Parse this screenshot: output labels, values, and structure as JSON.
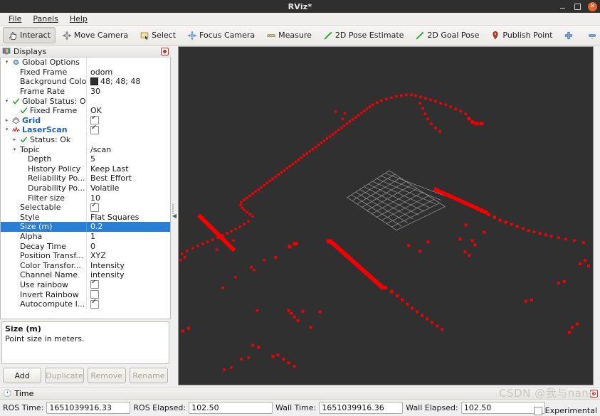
{
  "window": {
    "title": "RViz*",
    "min_label": "minimize",
    "max_label": "maximize",
    "close_label": "✕"
  },
  "menubar": [
    {
      "label": "File",
      "accel": "F"
    },
    {
      "label": "Panels",
      "accel": "P"
    },
    {
      "label": "Help",
      "accel": "H"
    }
  ],
  "toolbar": [
    {
      "label": "Interact",
      "icon": "hand-icon",
      "active": true
    },
    {
      "label": "Move Camera",
      "icon": "move-camera-icon",
      "active": false
    },
    {
      "label": "Select",
      "icon": "select-rect-icon",
      "active": false
    },
    {
      "label": "Focus Camera",
      "icon": "focus-camera-icon",
      "active": false
    },
    {
      "label": "Measure",
      "icon": "measure-icon",
      "active": false
    },
    {
      "label": "2D Pose Estimate",
      "icon": "pose-arrow-icon",
      "active": false
    },
    {
      "label": "2D Goal Pose",
      "icon": "pose-arrow-icon",
      "active": false
    },
    {
      "label": "Publish Point",
      "icon": "map-pin-icon",
      "active": false
    },
    {
      "label": "",
      "icon": "plus-icon",
      "active": false
    },
    {
      "label": "",
      "icon": "minus-icon",
      "active": false
    }
  ],
  "displays_panel": {
    "title": "Displays",
    "rows": [
      {
        "indent": 0,
        "arrow": "down",
        "icon": "gear-icon",
        "name": "Global Options",
        "style": "plain",
        "value": "",
        "value_type": "none"
      },
      {
        "indent": 1,
        "arrow": "none",
        "icon": "",
        "name": "Fixed Frame",
        "style": "plain",
        "value": "odom",
        "value_type": "text"
      },
      {
        "indent": 1,
        "arrow": "none",
        "icon": "",
        "name": "Background Color",
        "style": "plain",
        "value": "48; 48; 48",
        "value_type": "color"
      },
      {
        "indent": 1,
        "arrow": "none",
        "icon": "",
        "name": "Frame Rate",
        "style": "plain",
        "value": "30",
        "value_type": "text"
      },
      {
        "indent": 0,
        "arrow": "down",
        "icon": "check-icon",
        "name": "Global Status: Ok",
        "style": "plain",
        "value": "",
        "value_type": "none"
      },
      {
        "indent": 1,
        "arrow": "none",
        "icon": "check-icon",
        "name": "Fixed Frame",
        "style": "plain",
        "value": "OK",
        "value_type": "text"
      },
      {
        "indent": 0,
        "arrow": "right",
        "icon": "grid-icon",
        "name": "Grid",
        "style": "blue",
        "value": "",
        "value_type": "check-on"
      },
      {
        "indent": 0,
        "arrow": "down",
        "icon": "scan-icon",
        "name": "LaserScan",
        "style": "blue",
        "value": "",
        "value_type": "check-on"
      },
      {
        "indent": 1,
        "arrow": "right",
        "icon": "check-icon",
        "name": "Status: Ok",
        "style": "plain",
        "value": "",
        "value_type": "none"
      },
      {
        "indent": 1,
        "arrow": "down",
        "icon": "",
        "name": "Topic",
        "style": "plain",
        "value": "/scan",
        "value_type": "text"
      },
      {
        "indent": 2,
        "arrow": "none",
        "icon": "",
        "name": "Depth",
        "style": "plain",
        "value": "5",
        "value_type": "text"
      },
      {
        "indent": 2,
        "arrow": "none",
        "icon": "",
        "name": "History Policy",
        "style": "plain",
        "value": "Keep Last",
        "value_type": "text"
      },
      {
        "indent": 2,
        "arrow": "none",
        "icon": "",
        "name": "Reliability Po...",
        "style": "plain",
        "value": "Best Effort",
        "value_type": "text"
      },
      {
        "indent": 2,
        "arrow": "none",
        "icon": "",
        "name": "Durability Po...",
        "style": "plain",
        "value": "Volatile",
        "value_type": "text"
      },
      {
        "indent": 2,
        "arrow": "none",
        "icon": "",
        "name": "Filter size",
        "style": "plain",
        "value": "10",
        "value_type": "text"
      },
      {
        "indent": 1,
        "arrow": "none",
        "icon": "",
        "name": "Selectable",
        "style": "plain",
        "value": "",
        "value_type": "check-on"
      },
      {
        "indent": 1,
        "arrow": "none",
        "icon": "",
        "name": "Style",
        "style": "plain",
        "value": "Flat Squares",
        "value_type": "text"
      },
      {
        "indent": 1,
        "arrow": "none",
        "icon": "",
        "name": "Size (m)",
        "style": "plain",
        "value": "0.2",
        "value_type": "text",
        "selected": true
      },
      {
        "indent": 1,
        "arrow": "none",
        "icon": "",
        "name": "Alpha",
        "style": "plain",
        "value": "1",
        "value_type": "text"
      },
      {
        "indent": 1,
        "arrow": "none",
        "icon": "",
        "name": "Decay Time",
        "style": "plain",
        "value": "0",
        "value_type": "text"
      },
      {
        "indent": 1,
        "arrow": "none",
        "icon": "",
        "name": "Position Transf...",
        "style": "plain",
        "value": "XYZ",
        "value_type": "text"
      },
      {
        "indent": 1,
        "arrow": "none",
        "icon": "",
        "name": "Color Transfor...",
        "style": "plain",
        "value": "Intensity",
        "value_type": "text"
      },
      {
        "indent": 1,
        "arrow": "none",
        "icon": "",
        "name": "Channel Name",
        "style": "plain",
        "value": "intensity",
        "value_type": "text"
      },
      {
        "indent": 1,
        "arrow": "none",
        "icon": "",
        "name": "Use rainbow",
        "style": "plain",
        "value": "",
        "value_type": "check-on"
      },
      {
        "indent": 1,
        "arrow": "none",
        "icon": "",
        "name": "Invert Rainbow",
        "style": "plain",
        "value": "",
        "value_type": "check-off"
      },
      {
        "indent": 1,
        "arrow": "none",
        "icon": "",
        "name": "Autocompute I...",
        "style": "plain",
        "value": "",
        "value_type": "check-on"
      }
    ],
    "description": {
      "title": "Size (m)",
      "text": "Point size in meters."
    },
    "buttons": [
      {
        "label": "Add",
        "disabled": false
      },
      {
        "label": "Duplicate",
        "disabled": true
      },
      {
        "label": "Remove",
        "disabled": true
      },
      {
        "label": "Rename",
        "disabled": true
      }
    ]
  },
  "viewport": {
    "background_color": "#303030",
    "point_color": "#ff0000",
    "grid_color": "#bdbdbd"
  },
  "time_panel": {
    "title": "Time",
    "fields": [
      {
        "label": "ROS Time:",
        "value": "1651039916.33"
      },
      {
        "label": "ROS Elapsed:",
        "value": "102.50"
      },
      {
        "label": "Wall Time:",
        "value": "1651039916.36"
      },
      {
        "label": "Wall Elapsed:",
        "value": "102.50"
      }
    ],
    "experimental_label": "Experimental",
    "experimental_checked": false
  },
  "watermark": "CSDN @我与nano"
}
